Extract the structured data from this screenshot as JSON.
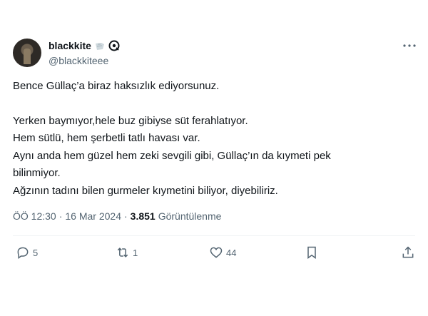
{
  "author": {
    "display_name": "blackkite",
    "handle": "@blackkiteee"
  },
  "tweet": {
    "lines": [
      "Bence Güllaç’a biraz haksızlık ediyorsunuz.",
      "Yerken baymıyor,hele buz gibiyse süt ferahlatıyor.",
      "Hem sütlü, hem şerbetli tatlı havası var.",
      "Aynı anda hem  güzel hem zeki sevgili gibi, Güllaç’ın da kıymeti pek",
      "bilinmiyor.",
      "Ağzının tadını bilen gurmeler kıymetini biliyor, diyebiliriz."
    ]
  },
  "meta": {
    "time": "ÖÖ 12:30",
    "sep1": "·",
    "date": "16 Mar 2024",
    "sep2": "·",
    "views_count": "3.851",
    "views_label": "Görüntülenme"
  },
  "actions": {
    "replies": "5",
    "retweets": "1",
    "likes": "44"
  },
  "icons": {
    "more": "more-horizontal-icon",
    "reply": "reply-icon",
    "retweet": "retweet-icon",
    "like": "heart-icon",
    "bookmark": "bookmark-icon",
    "share": "share-icon"
  }
}
